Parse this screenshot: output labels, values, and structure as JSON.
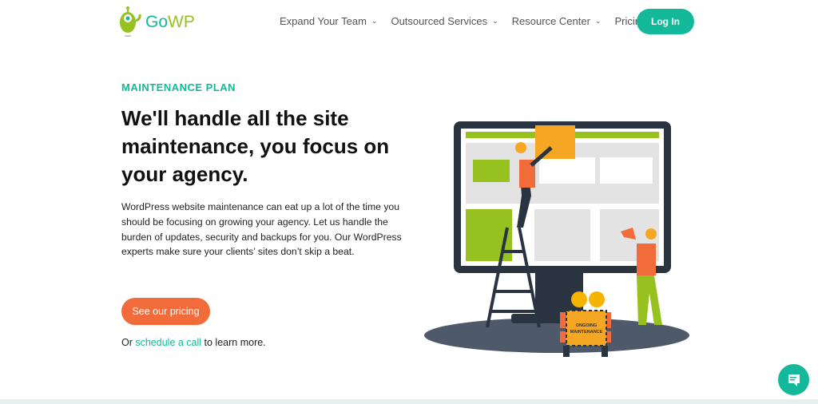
{
  "nav": {
    "logo": {
      "part1": "Go",
      "part2": "WP"
    },
    "items": [
      {
        "label": "Expand Your Team",
        "dropdown": true
      },
      {
        "label": "Outsourced Services",
        "dropdown": true
      },
      {
        "label": "Resource Center",
        "dropdown": true
      },
      {
        "label": "Pricing",
        "dropdown": false
      }
    ],
    "login": "Log In"
  },
  "hero": {
    "eyebrow": "MAINTENANCE PLAN",
    "title": "We'll handle all the site maintenance, you focus on your agency.",
    "description": "WordPress website maintenance can eat up a lot of the time you should be focusing on growing your agency. Let us handle the burden of updates, security and backups for you. Our WordPress experts make sure your clients’ sites don’t skip a beat.",
    "cta": "See our pricing",
    "secondary": {
      "prefix": "Or ",
      "link": "schedule a call",
      "suffix": " to learn more."
    },
    "sign_text": "ONGOING MAINTENANCE"
  },
  "colors": {
    "accent": "#13b99a",
    "cta": "#f26b3a",
    "lime": "#97c11f"
  },
  "chat_icon": "chat-bubble-icon"
}
